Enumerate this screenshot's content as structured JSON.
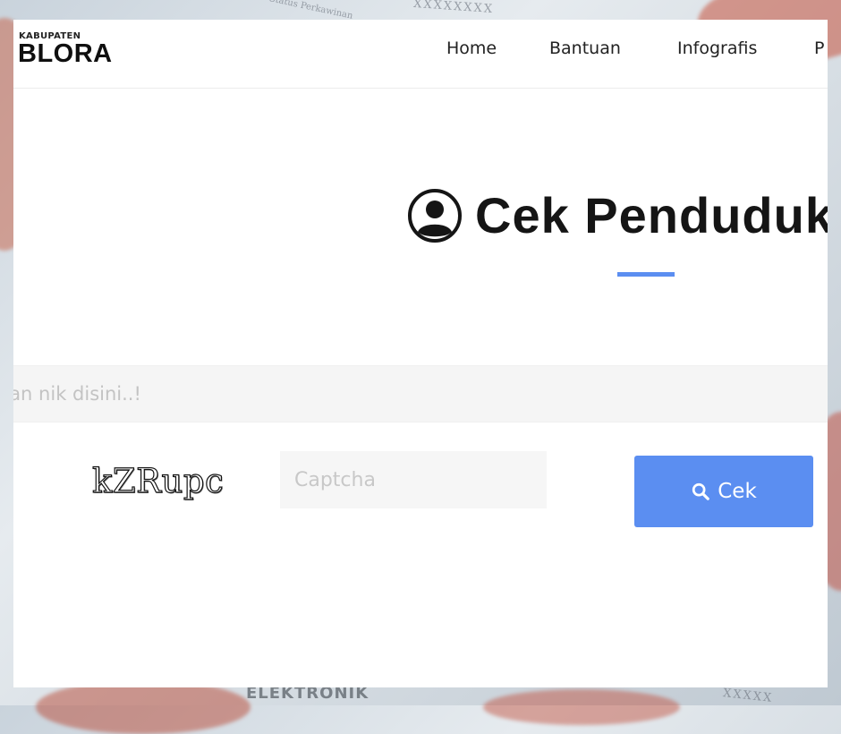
{
  "background": {
    "text_top": "XXXXXXXX",
    "text_top_small": "Status Perkawinan",
    "text_bottom": "ELEKTRONIK",
    "text_bottom_right": "XXXXX"
  },
  "header": {
    "logo_small": "KABUPATEN",
    "logo_big": "BLORA",
    "nav": [
      "Home",
      "Bantuan",
      "Infografis",
      "P"
    ]
  },
  "hero": {
    "icon": "user-circle-icon",
    "title": "Cek Penduduk"
  },
  "form": {
    "nik_placeholder": "Masukkan nik disini..!",
    "captcha_text": "kZRupc",
    "captcha_placeholder": "Captcha",
    "submit_icon": "search-icon",
    "submit_label": "Cek"
  },
  "colors": {
    "accent": "#5b8ef1",
    "title": "#151515",
    "input_bg": "#f5f5f5"
  }
}
